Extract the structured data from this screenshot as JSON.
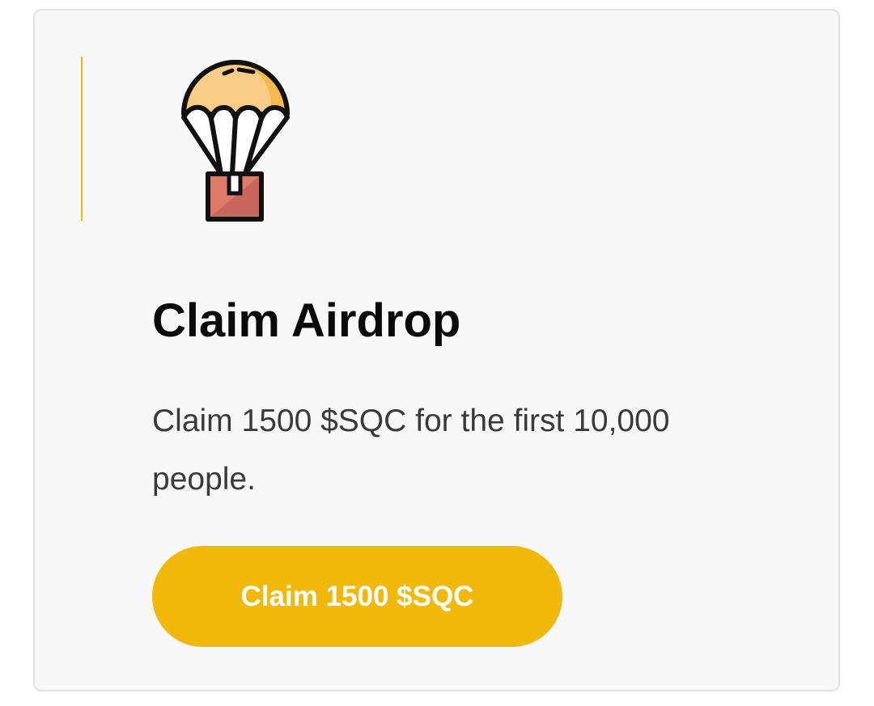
{
  "card": {
    "icon": "parachute-airdrop-icon",
    "title": "Claim Airdrop",
    "description": "Claim 1500 $SQC for the first 10,000 people.",
    "button_label": "Claim 1500 $SQC"
  },
  "colors": {
    "accent": "#f0b90b",
    "card_background": "#f8f8f8",
    "card_border": "#e2e2e2",
    "title_text": "#0a0a0a",
    "body_text": "#3a3a3a",
    "button_text": "#ffffff",
    "parachute_fill": "#f9cd87",
    "parachute_shade": "#f5b94f",
    "box_fill": "#e07a6a",
    "box_shade": "#c9675b"
  }
}
